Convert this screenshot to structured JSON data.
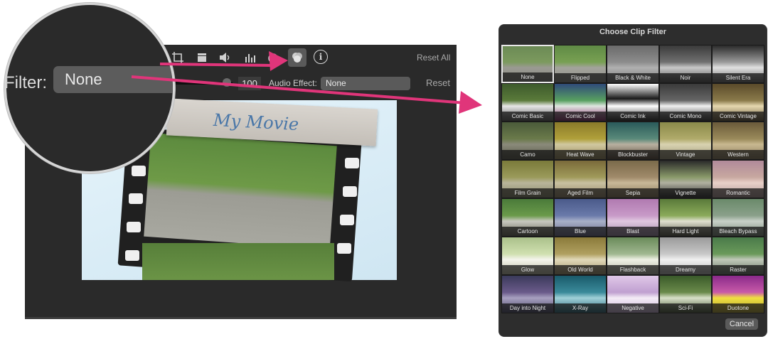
{
  "editor": {
    "toolbar_icons": [
      "crop-icon",
      "camera-icon",
      "volume-icon",
      "equalizer-icon",
      "speedometer-icon",
      "color-filter-icon",
      "info-icon"
    ],
    "info_glyph": "i",
    "reset_all_label": "Reset All",
    "volume_value": "100",
    "audio_effect_label": "Audio Effect:",
    "audio_effect_value": "None",
    "reset_label": "Reset",
    "movie_title": "My Movie"
  },
  "magnifier": {
    "filter_label": "Filter:",
    "filter_value": "None"
  },
  "dialog": {
    "title": "Choose Clip Filter",
    "selected": "None",
    "cancel_label": "Cancel",
    "filters": [
      "None",
      "Flipped",
      "Black & White",
      "Noir",
      "Silent Era",
      "Comic Basic",
      "Comic Cool",
      "Comic Ink",
      "Comic Mono",
      "Comic Vintage",
      "Camo",
      "Heat Wave",
      "Blockbuster",
      "Vintage",
      "Western",
      "Film Grain",
      "Aged Film",
      "Sepia",
      "Vignette",
      "Romantic",
      "Cartoon",
      "Blue",
      "Blast",
      "Hard Light",
      "Bleach Bypass",
      "Glow",
      "Old World",
      "Flashback",
      "Dreamy",
      "Raster",
      "Day into Night",
      "X-Ray",
      "Negative",
      "Sci-Fi",
      "Duotone"
    ]
  },
  "colors": {
    "accent_arrow": "#e0357a",
    "panel_bg": "#2a2a2a",
    "dialog_bg": "#2d2d2d"
  }
}
